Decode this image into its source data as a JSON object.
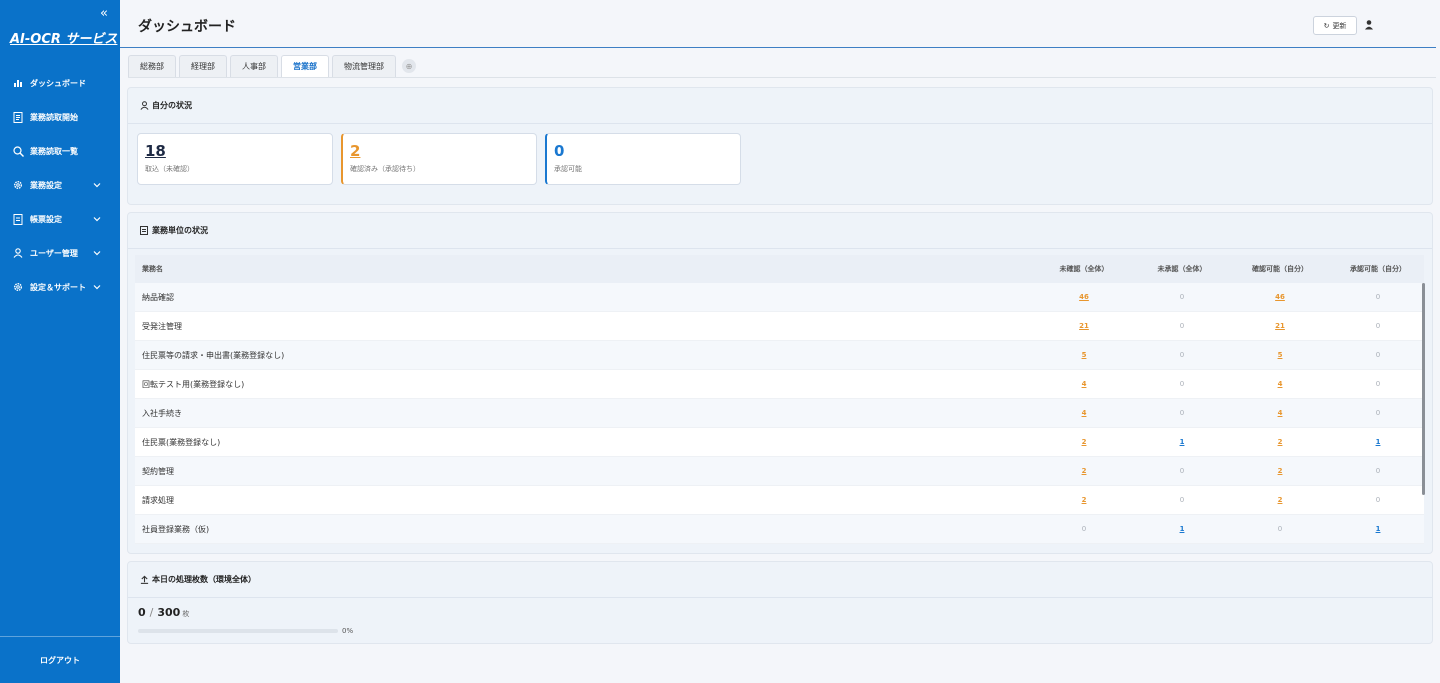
{
  "app": {
    "title": "AI-OCR サービス"
  },
  "sidebar": {
    "items": [
      {
        "label": "ダッシュボード",
        "has_submenu": false
      },
      {
        "label": "業務読取開始",
        "has_submenu": false
      },
      {
        "label": "業務読取一覧",
        "has_submenu": false
      },
      {
        "label": "業務設定",
        "has_submenu": true
      },
      {
        "label": "帳票設定",
        "has_submenu": true
      },
      {
        "label": "ユーザー管理",
        "has_submenu": true
      },
      {
        "label": "設定＆サポート",
        "has_submenu": true
      }
    ],
    "logout_label": "ログアウト"
  },
  "header": {
    "title": "ダッシュボード",
    "refresh_label": "更新"
  },
  "tabs": [
    {
      "label": "総務部",
      "active": false
    },
    {
      "label": "経理部",
      "active": false
    },
    {
      "label": "人事部",
      "active": false
    },
    {
      "label": "営業部",
      "active": true
    },
    {
      "label": "物流管理部",
      "active": false
    }
  ],
  "my_status": {
    "title": "自分の状況",
    "cards": [
      {
        "value": "18",
        "label": "取込（未確認）"
      },
      {
        "value": "2",
        "label": "確認済み（承認待ち）"
      },
      {
        "value": "0",
        "label": "承認可能"
      }
    ]
  },
  "business_status": {
    "title": "業務単位の状況",
    "columns": [
      "業務名",
      "未確認（全体）",
      "未承認（全体）",
      "確認可能（自分）",
      "承認可能（自分）"
    ],
    "rows": [
      {
        "name": "納品確認",
        "values": [
          "46",
          "0",
          "46",
          "0"
        ]
      },
      {
        "name": "受発注管理",
        "values": [
          "21",
          "0",
          "21",
          "0"
        ]
      },
      {
        "name": "住民票等の請求・申出書(業務登録なし)",
        "values": [
          "5",
          "0",
          "5",
          "0"
        ]
      },
      {
        "name": "回転テスト用(業務登録なし)",
        "values": [
          "4",
          "0",
          "4",
          "0"
        ]
      },
      {
        "name": "入社手続き",
        "values": [
          "4",
          "0",
          "4",
          "0"
        ]
      },
      {
        "name": "住民票(業務登録なし)",
        "values": [
          "2",
          "1",
          "2",
          "1"
        ]
      },
      {
        "name": "契約管理",
        "values": [
          "2",
          "0",
          "2",
          "0"
        ]
      },
      {
        "name": "請求処理",
        "values": [
          "2",
          "0",
          "2",
          "0"
        ]
      },
      {
        "name": "社員登録業務（仮)",
        "values": [
          "0",
          "1",
          "0",
          "1"
        ]
      }
    ]
  },
  "processing": {
    "title": "本日の処理枚数（環境全体）",
    "current": "0",
    "separator": "/",
    "max": "300",
    "unit": "枚",
    "percent_label": "0%",
    "progress_fraction": 0
  },
  "colors": {
    "sidebar_bg": "#0a72c9",
    "accent_orange": "#e8962e",
    "accent_blue": "#1a78d0"
  }
}
